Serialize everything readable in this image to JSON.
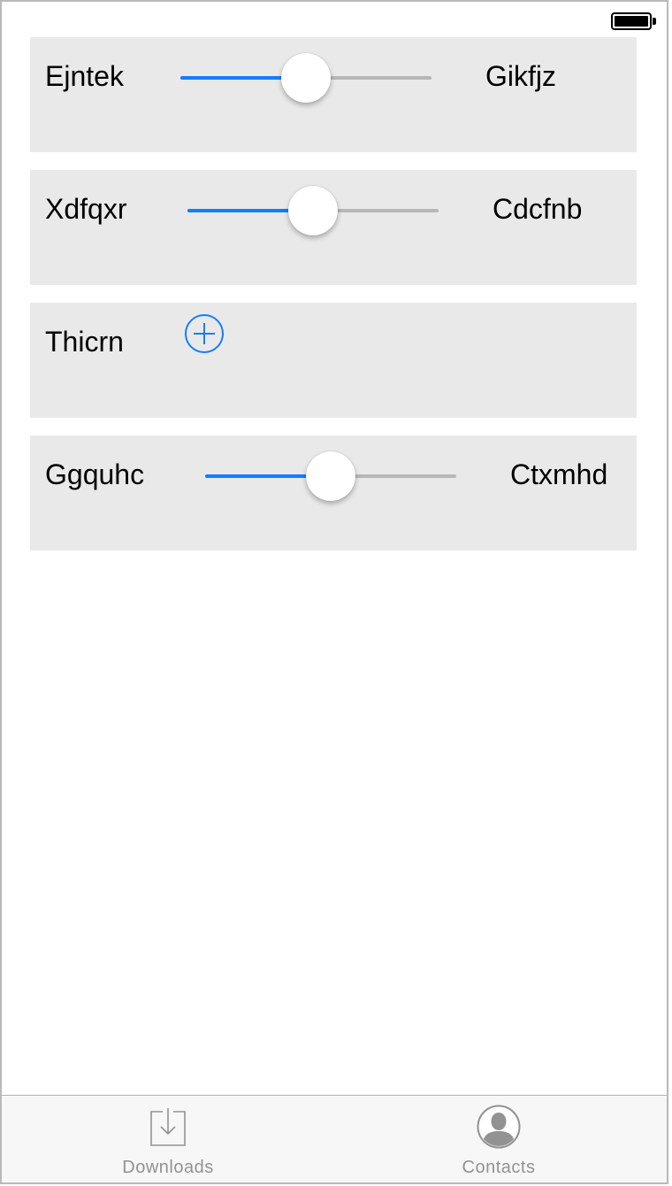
{
  "status_bar": {
    "battery_icon": "battery-full-icon"
  },
  "rows": [
    {
      "label": "Ejntek",
      "value_label": "Gikfjz",
      "control": "slider",
      "slider_level": 0.5
    },
    {
      "label": "Xdfqxr",
      "value_label": "Cdcfnb",
      "control": "slider",
      "slider_level": 0.5
    },
    {
      "label": "Thicrn",
      "control": "add-button",
      "icon": "plus-circle-icon"
    },
    {
      "label": "Ggquhc",
      "value_label": "Ctxmhd",
      "control": "slider",
      "slider_level": 0.5
    }
  ],
  "tab_bar": {
    "items": [
      {
        "label": "Downloads",
        "icon": "download-icon"
      },
      {
        "label": "Contacts",
        "icon": "contact-icon"
      }
    ]
  },
  "colors": {
    "accent": "#147efb",
    "row_background": "#e9e9e9",
    "slider_track": "#b7b7b7",
    "tab_label": "#929292",
    "tabbar_background": "#f7f7f7"
  }
}
